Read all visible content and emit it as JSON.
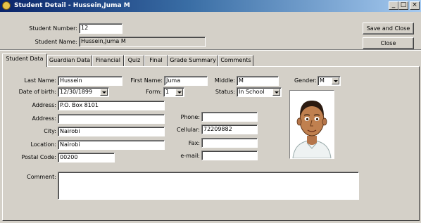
{
  "window": {
    "title": "Student Detail - Hussein,Juma M",
    "icon": "app-user-icon",
    "controls": {
      "minimize": "_",
      "maximize": "□",
      "close": "×"
    }
  },
  "header": {
    "student_number_label": "Student Number:",
    "student_number": "12",
    "student_name_label": "Student Name:",
    "student_name": "Hussein,Juma M",
    "save_close": "Save and Close",
    "close": "Close"
  },
  "tabs": [
    {
      "label": "Student Data",
      "selected": true
    },
    {
      "label": "Guardian Data"
    },
    {
      "label": "Financial"
    },
    {
      "label": "Quiz"
    },
    {
      "label": "Final"
    },
    {
      "label": "Grade Summary"
    },
    {
      "label": "Comments"
    }
  ],
  "form": {
    "last_name_label": "Last Name:",
    "last_name": "Hussein",
    "first_name_label": "First Name:",
    "first_name": "Juma",
    "middle_label": "Middle:",
    "middle": "M",
    "gender_label": "Gender:",
    "gender": "M",
    "dob_label": "Date of birth:",
    "dob": "12/30/1899",
    "form_label": "Form:",
    "form": "1",
    "status_label": "Status:",
    "status": "In School",
    "address_label": "Address:",
    "address1": "P.O. Box 8101",
    "address2_label": "Address:",
    "address2": "",
    "city_label": "City:",
    "city": "Nairobi",
    "location_label": "Location:",
    "location": "Nairobi",
    "postal_label": "Postal Code:",
    "postal": "00200",
    "phone_label": "Phone:",
    "phone": "",
    "cellular_label": "Cellular:",
    "cellular": "72209882",
    "fax_label": "Fax:",
    "fax": "",
    "email_label": "e-mail:",
    "email": "",
    "comment_label": "Comment:",
    "comment": ""
  },
  "photo": {
    "icon": "student-portrait-icon"
  }
}
